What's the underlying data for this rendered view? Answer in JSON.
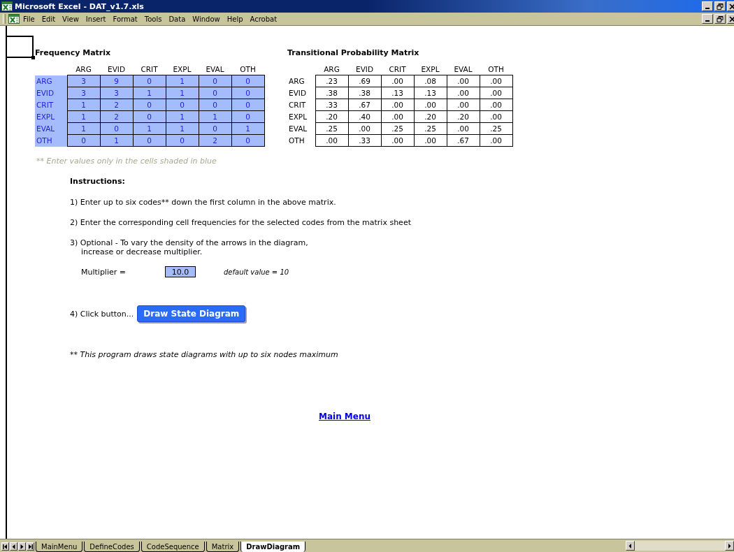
{
  "window": {
    "title": "Microsoft Excel - DAT_v1.7.xls"
  },
  "menu_bar": {
    "items": [
      "File",
      "Edit",
      "View",
      "Insert",
      "Format",
      "Tools",
      "Data",
      "Window",
      "Help",
      "Acrobat"
    ]
  },
  "frequency_matrix": {
    "title": "Frequency Matrix",
    "columns": [
      "ARG",
      "EVID",
      "CRIT",
      "EXPL",
      "EVAL",
      "OTH"
    ],
    "rows": [
      {
        "label": "ARG",
        "cells": [
          "3",
          "9",
          "0",
          "1",
          "0",
          "0"
        ]
      },
      {
        "label": "EVID",
        "cells": [
          "3",
          "3",
          "1",
          "1",
          "0",
          "0"
        ]
      },
      {
        "label": "CRIT",
        "cells": [
          "1",
          "2",
          "0",
          "0",
          "0",
          "0"
        ]
      },
      {
        "label": "EXPL",
        "cells": [
          "1",
          "2",
          "0",
          "1",
          "1",
          "0"
        ]
      },
      {
        "label": "EVAL",
        "cells": [
          "1",
          "0",
          "1",
          "1",
          "0",
          "1"
        ]
      },
      {
        "label": "OTH",
        "cells": [
          "0",
          "1",
          "0",
          "0",
          "2",
          "0"
        ]
      }
    ]
  },
  "probability_matrix": {
    "title": "Transitional Probability Matrix",
    "columns": [
      "ARG",
      "EVID",
      "CRIT",
      "EXPL",
      "EVAL",
      "OTH"
    ],
    "rows": [
      {
        "label": "ARG",
        "cells": [
          ".23",
          ".69",
          ".00",
          ".08",
          ".00",
          ".00"
        ]
      },
      {
        "label": "EVID",
        "cells": [
          ".38",
          ".38",
          ".13",
          ".13",
          ".00",
          ".00"
        ]
      },
      {
        "label": "CRIT",
        "cells": [
          ".33",
          ".67",
          ".00",
          ".00",
          ".00",
          ".00"
        ]
      },
      {
        "label": "EXPL",
        "cells": [
          ".20",
          ".40",
          ".00",
          ".20",
          ".20",
          ".00"
        ]
      },
      {
        "label": "EVAL",
        "cells": [
          ".25",
          ".00",
          ".25",
          ".25",
          ".00",
          ".25"
        ]
      },
      {
        "label": "OTH",
        "cells": [
          ".00",
          ".33",
          ".00",
          ".00",
          ".67",
          ".00"
        ]
      }
    ]
  },
  "shaded_note": "** Enter values only in the cells shaded in blue",
  "instructions": {
    "heading": "Instructions:",
    "steps": [
      "1) Enter up to six codes** down the first column in the above matrix.",
      "2) Enter the corresponding cell frequencies for the selected codes from the matrix sheet"
    ],
    "optional_step": {
      "lines": [
        "3) Optional - To vary the density of the arrows in the diagram,",
        "increase or decrease multiplier."
      ]
    },
    "multiplier": {
      "label": "Multiplier =",
      "value": "10.0",
      "hint": "default value = 10"
    },
    "click_step": {
      "label": "4) Click button...",
      "button": "Draw State Diagram"
    },
    "footnote": "** This program draws state diagrams with up to six nodes maximum"
  },
  "main_menu_link": "Main Menu",
  "sheet_tabs": [
    {
      "label": "MainMenu",
      "selected": false
    },
    {
      "label": "DefineCodes",
      "selected": false
    },
    {
      "label": "CodeSequence",
      "selected": false
    },
    {
      "label": "Matrix",
      "selected": false
    },
    {
      "label": "DrawDiagram",
      "selected": true
    }
  ]
}
